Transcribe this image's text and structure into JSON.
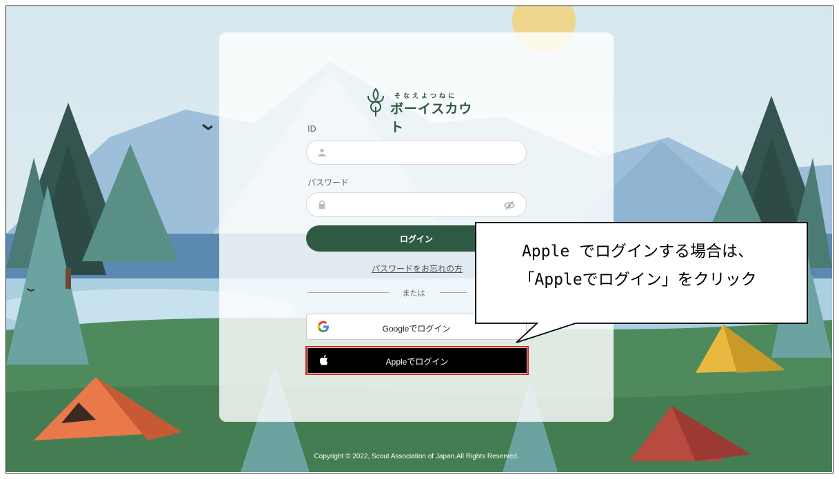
{
  "logo": {
    "tagline": "そなえよつねに",
    "name": "ボーイスカウト"
  },
  "form": {
    "id_label": "ID",
    "id_value": "",
    "password_label": "パスワード",
    "password_value": "",
    "login_button": "ログイン",
    "forgot_link": "パスワードをお忘れの方",
    "divider_text": "または",
    "google_button": "Googleでログイン",
    "apple_button": "Appleでログイン"
  },
  "callout": {
    "line1": "Apple でログインする場合は、",
    "line2": "「Appleでログイン」をクリック"
  },
  "footer": {
    "copyright": "Copyright © 2022, Scout Association of Japan.All Rights Reserved."
  },
  "colors": {
    "primary": "#2e5a44",
    "highlight": "#e0201f",
    "apple_bg": "#000000",
    "sky": "#cfe3ec",
    "grass": "#4f8a5c"
  },
  "icons": [
    "user-icon",
    "lock-icon",
    "eye-off-icon",
    "google-icon",
    "apple-icon",
    "scout-emblem-icon"
  ]
}
